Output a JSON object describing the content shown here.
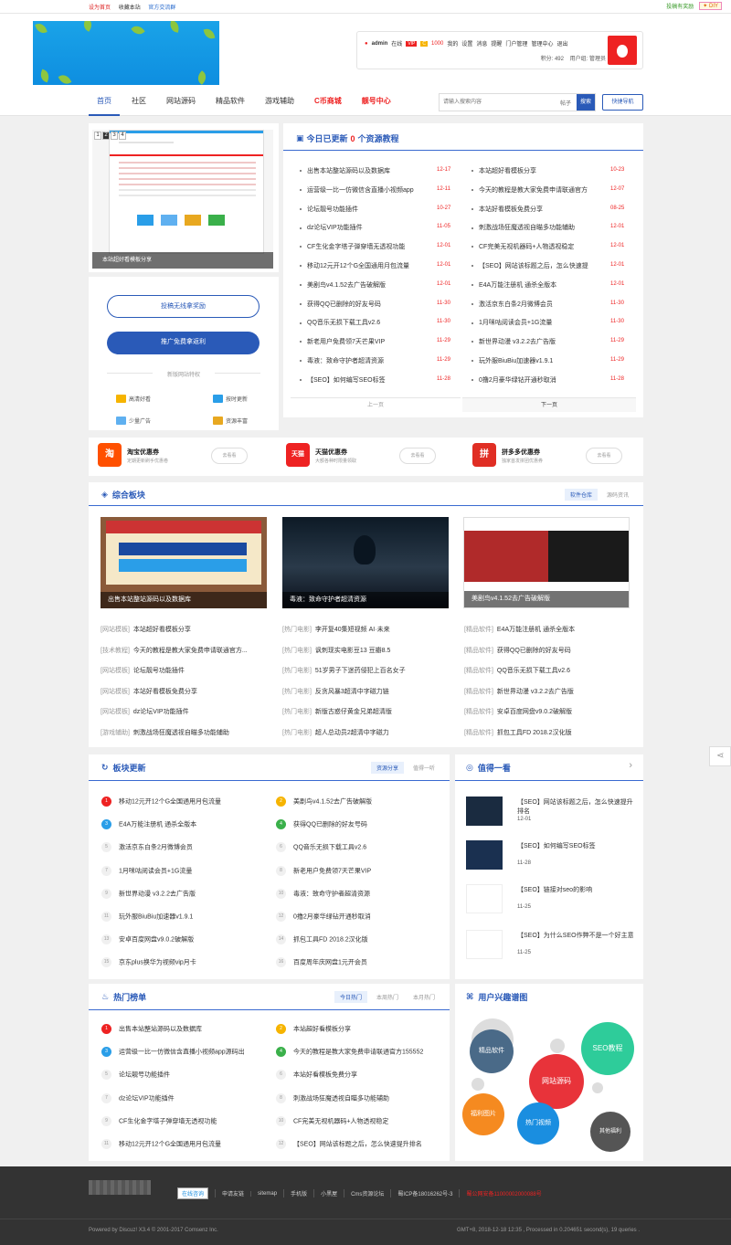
{
  "topbar": {
    "set_home": "设为首页",
    "bookmark": "收藏本站",
    "official_group": "官方交流群",
    "promo_label": "投稿有奖励",
    "diy_label": "DIY"
  },
  "user": {
    "name": "admin",
    "status": "在线",
    "badge": "1000",
    "links": [
      "我的",
      "设置",
      "消息",
      "提醒",
      "门户管理",
      "管理中心",
      "退出"
    ],
    "points_label": "积分: 492",
    "group_label": "用户组: 管理员"
  },
  "nav": {
    "items": [
      "首页",
      "社区",
      "网站源码",
      "精品软件",
      "游戏辅助",
      "C币商城",
      "靓号中心"
    ],
    "search_placeholder": "请输入搜索内容",
    "search_type": "帖子",
    "search_button": "搜索",
    "quick_nav": "快捷导航"
  },
  "slider": {
    "pages": [
      "1",
      "2",
      "3",
      "4"
    ],
    "caption": "本站超好看模板分享"
  },
  "promo": {
    "btn_submit": "投稿无线拿奖励",
    "btn_promote": "推广免费拿返利",
    "features_title": "新版网站特权",
    "features": [
      "高清好看",
      "按时更新",
      "少量广告",
      "资源丰富"
    ]
  },
  "today": {
    "prefix": "今日已更新",
    "count": "0",
    "suffix": "个资源教程",
    "left": [
      {
        "t": "出售本站整站源码以及数据库",
        "d": "12-17"
      },
      {
        "t": "运营级一比一仿微信含直播小视频app",
        "d": "12-11"
      },
      {
        "t": "论坛靓号功能插件",
        "d": "10-27"
      },
      {
        "t": "dz论坛VIP功能插件",
        "d": "11-05"
      },
      {
        "t": "CF生化金字塔子弹穿墙无透视功能",
        "d": "12-01"
      },
      {
        "t": "移动12元开12个G全国通用月包流量",
        "d": "12-01"
      },
      {
        "t": "美剧鸟v4.1.52去广告破解版",
        "d": "12-01"
      },
      {
        "t": "获得QQ已删除的好友号码",
        "d": "11-30"
      },
      {
        "t": "QQ音乐无损下载工具v2.6",
        "d": "11-30"
      },
      {
        "t": "新老用户免费领7天芒果VIP",
        "d": "11-29"
      },
      {
        "t": "毒液：致命守护者超清资源",
        "d": "11-29"
      },
      {
        "t": "【SEO】如何编写SEO标签",
        "d": "11-28"
      }
    ],
    "right": [
      {
        "t": "本站超好看模板分享",
        "d": "10-23"
      },
      {
        "t": "今天的教程是教大家免费申请联通官方",
        "d": "12-07"
      },
      {
        "t": "本站好看模板免费分享",
        "d": "08-25"
      },
      {
        "t": "刺激战场狂魔透视自瞄多功能辅助",
        "d": "12-01"
      },
      {
        "t": "CF完美无视机器码+人物透视稳定",
        "d": "12-01"
      },
      {
        "t": "【SEO】网站该标题之后，怎么快速提",
        "d": "12-01"
      },
      {
        "t": "E4A万能注册机 通杀全版本",
        "d": "12-01"
      },
      {
        "t": "激活京东白条2月微博会员",
        "d": "11-30"
      },
      {
        "t": "1月咪咕阅读会员+1G流量",
        "d": "11-30"
      },
      {
        "t": "新世界动漫 v3.2.2去广告版",
        "d": "11-29"
      },
      {
        "t": "玩外服BiuBiu加速器v1.9.1",
        "d": "11-29"
      },
      {
        "t": "0撸2月豪华绿钻开通秒取消",
        "d": "11-28"
      }
    ],
    "prev": "上一页",
    "next": "下一页"
  },
  "coupons": [
    {
      "icon": "淘",
      "title": "淘宝优惠券",
      "sub": "定期更新刷手优惠卷",
      "btn": "去看看",
      "color": "#ff5000"
    },
    {
      "icon": "天猫",
      "title": "天猫优惠券",
      "sub": "大额各种时限量领取",
      "btn": "去看看",
      "color": "#e22"
    },
    {
      "icon": "拼",
      "title": "拼多多优惠券",
      "sub": "独家首发拼团优惠券",
      "btn": "去看看",
      "color": "#e02e24"
    }
  ],
  "combined": {
    "title": "综合板块",
    "tabs": [
      "软件仓库",
      "源码资讯"
    ],
    "pics": [
      "出售本站整站源码以及数据库",
      "毒液：致命守护者超清资源",
      "美剧鸟v4.1.52去广告破解版"
    ],
    "col1": [
      {
        "c": "[网站模板]",
        "t": "本站超好看模板分享"
      },
      {
        "c": "[技术教程]",
        "t": "今天的教程是教大家免费申请联通官方..."
      },
      {
        "c": "[网站模板]",
        "t": "论坛靓号功能插件"
      },
      {
        "c": "[网站模板]",
        "t": "本站好看模板免费分享"
      },
      {
        "c": "[网站模板]",
        "t": "dz论坛VIP功能插件"
      },
      {
        "c": "[游戏辅助]",
        "t": "刺激战场狂魔透视自瞄多功能辅助"
      }
    ],
    "col2": [
      {
        "c": "[热门电影]",
        "t": "李开复40集短视频 AI·未来"
      },
      {
        "c": "[热门电影]",
        "t": "讽刺现实电影豆13 豆瓣8.5"
      },
      {
        "c": "[热门电影]",
        "t": "51岁男子下迷药侵犯上百名女子"
      },
      {
        "c": "[热门电影]",
        "t": "反贪风暴3超清中字磁力链"
      },
      {
        "c": "[热门电影]",
        "t": "新版古惑仔黄金兄弟超清版"
      },
      {
        "c": "[热门电影]",
        "t": "超人总动员2超清中字磁力"
      }
    ],
    "col3": [
      {
        "c": "[精品软件]",
        "t": "E4A万能注册机 通杀全版本"
      },
      {
        "c": "[精品软件]",
        "t": "获得QQ已删除的好友号码"
      },
      {
        "c": "[精品软件]",
        "t": "QQ音乐无损下载工具v2.6"
      },
      {
        "c": "[精品软件]",
        "t": "新世界动漫 v3.2.2去广告版"
      },
      {
        "c": "[精品软件]",
        "t": "安卓百度网盘v9.0.2破解版"
      },
      {
        "c": "[精品软件]",
        "t": "抓包工具FD 2018.2汉化版"
      }
    ]
  },
  "block": {
    "title": "板块更新",
    "tabs": [
      "资源分享",
      "值得一听"
    ],
    "left": [
      "移动12元开12个G全国通用月包流量",
      "E4A万能注册机 通杀全版本",
      "激活京东白条2月微博会员",
      "1月咪咕阅读会员+1G流量",
      "新世界动漫 v3.2.2去广告版",
      "玩外服BiuBiu加速器v1.9.1",
      "安卓百度网盘v9.0.2破解版",
      "京东plus换华为视频vip月卡"
    ],
    "right": [
      "美剧鸟v4.1.52去广告破解版",
      "获得QQ已删除的好友号码",
      "QQ音乐无损下载工具v2.6",
      "新老用户免费领7天芒果VIP",
      "毒液：致命守护者超清资源",
      "0撸2月豪华绿钻开通秒取消",
      "抓包工具FD 2018.2汉化版",
      "百度周年庆网盘1元开会员"
    ]
  },
  "worth": {
    "title": "值得一看",
    "items": [
      {
        "t": "【SEO】网站该标题之后，怎么快速提升排名",
        "d": "12-01"
      },
      {
        "t": "【SEO】如何编写SEO标签",
        "d": "11-28"
      },
      {
        "t": "【SEO】链接对seo的影响",
        "d": "11-25"
      },
      {
        "t": "【SEO】为什么SEO作弊不是一个好主意",
        "d": "11-25"
      }
    ]
  },
  "hot": {
    "title": "热门榜单",
    "tabs": [
      "今日热门",
      "本周热门",
      "本月热门"
    ],
    "left": [
      "出售本站整站源码以及数据库",
      "运营级一比一仿微信含直播小视频app源码出",
      "论坛靓号功能插件",
      "dz论坛VIP功能插件",
      "CF生化金字塔子弹穿墙无透视功能",
      "移动12元开12个G全国通用月包流量"
    ],
    "right": [
      "本站超好看模板分享",
      "今天的教程是教大家免费申请联通官方155552",
      "本站好看模板免费分享",
      "刺激战场狂魔透视自瞄多功能辅助",
      "CF完美无视机器码+人物透视稳定",
      "【SEO】网站该标题之后，怎么快速提升排名"
    ]
  },
  "interest": {
    "title": "用户兴趣谱图",
    "bubbles": [
      "精品软件",
      "SEO教程",
      "网站源码",
      "福利图片",
      "热门视频",
      "其他福利"
    ]
  },
  "footer": {
    "online_service": "在线咨询",
    "links": [
      "申请友链",
      "sitemap",
      "手机版",
      "小黑屋",
      "Cms资源论坛",
      "蜀ICP备18016262号-3",
      "蜀公网安备11000002000088号"
    ],
    "copyright": "Powered by Discuz! X3.4 © 2001-2017 Comsenz Inc.",
    "gmt": "GMT+8, 2018-12-18 12:35 , Processed in 0.204651 second(s), 19 queries ."
  }
}
